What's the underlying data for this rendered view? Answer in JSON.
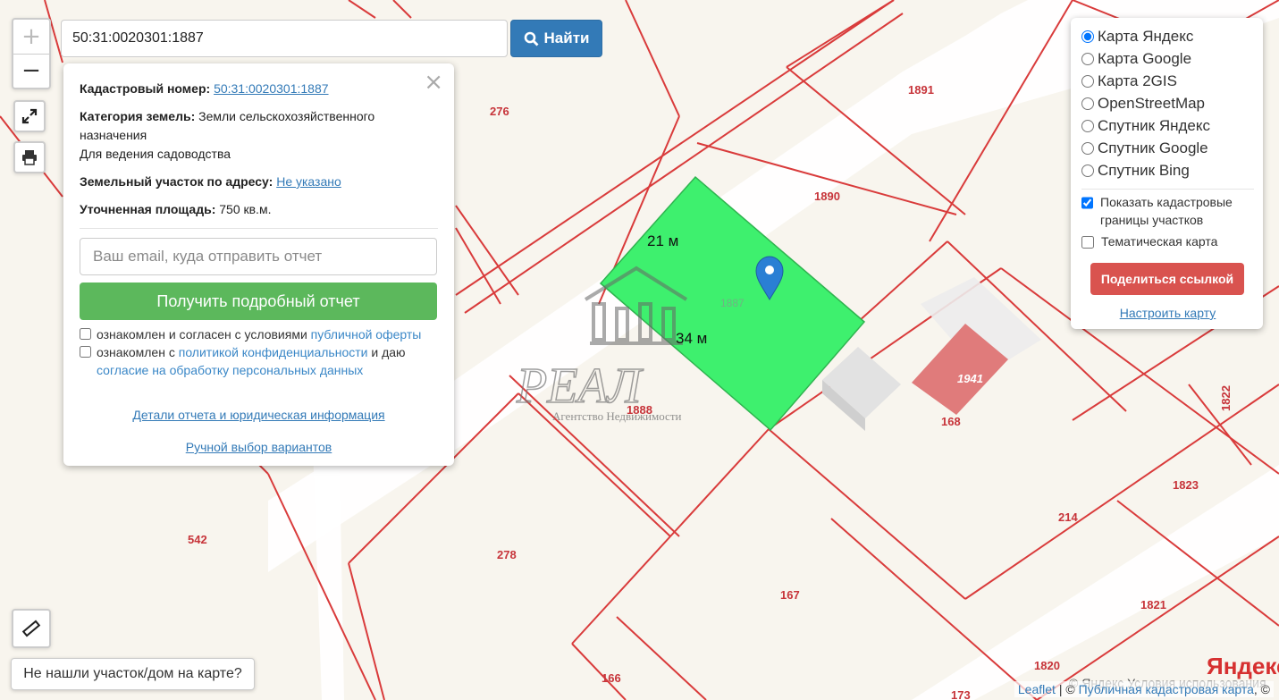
{
  "search": {
    "value": "50:31:0020301:1887",
    "button_label": "Найти"
  },
  "zoom": {
    "in": "+",
    "out": "−"
  },
  "popup": {
    "cad_label": "Кадастровый номер:",
    "cad_value": "50:31:0020301:1887",
    "category_label": "Категория земель:",
    "category_value": "Земли сельскохозяйственного назначения",
    "use_value": "Для ведения садоводства",
    "address_label": "Земельный участок по адресу:",
    "address_value": "Не указано",
    "area_label": "Уточненная площадь:",
    "area_value": "750 кв.м.",
    "email_placeholder": "Ваш email, куда отправить отчет",
    "report_button": "Получить подробный отчет",
    "agree1_text": "ознакомлен и согласен с условиями",
    "agree1_link": "публичной оферты",
    "agree2_text": "ознакомлен с",
    "agree2_link": "политикой конфиденциальности",
    "agree2_text2": "и даю",
    "agree2_link2": "согласие на обработку персональных данных",
    "details_link": "Детали отчета и юридическая информация",
    "manual_link": "Ручной выбор вариантов"
  },
  "layers": {
    "options": [
      "Карта Яндекс",
      "Карта Google",
      "Карта 2GIS",
      "OpenStreetMap",
      "Спутник Яндекс",
      "Спутник Google",
      "Спутник Bing"
    ],
    "selected": "Карта Яндекс",
    "show_borders": "Показать кадастровые границы участков",
    "thematic": "Тематическая карта",
    "share_button": "Поделиться ссылкой",
    "tune_link": "Настроить карту"
  },
  "not_found": "Не нашли участок/дом на карте?",
  "map": {
    "parcels": [
      "276",
      "1891",
      "1890",
      "1887",
      "1888",
      "168",
      "1941",
      "1822",
      "1823",
      "214",
      "542",
      "278",
      "167",
      "1821",
      "166",
      "1820",
      "173"
    ],
    "dim_top": "21 м",
    "dim_side": "34 м",
    "watermark_title": "РЕАЛ",
    "watermark_sub": "Агентство Недвижимости"
  },
  "attribution": {
    "leaflet": "Leaflet",
    "sep": " | © ",
    "pkk": "Публичная кадастровая карта",
    "tail": ", ©"
  },
  "yandex": {
    "copy": "© Яндекс Условия использования",
    "logo": "Яндекс"
  },
  "colors": {
    "parcel_highlight": "#3ef06e",
    "border_red": "#d93b3b",
    "primary": "#337ab7",
    "success": "#5cb85c",
    "danger": "#d9534f"
  }
}
